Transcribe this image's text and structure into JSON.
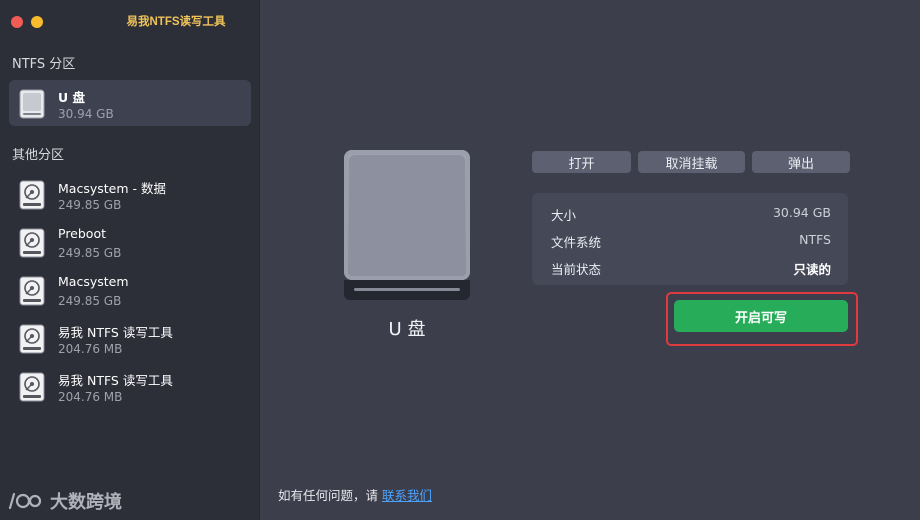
{
  "app": {
    "title": "易我NTFS读写工具"
  },
  "sidebar": {
    "ntfs_label": "NTFS 分区",
    "other_label": "其他分区",
    "ntfs_items": [
      {
        "name": "U 盘",
        "size": "30.94 GB"
      }
    ],
    "other_items": [
      {
        "name": "Macsystem - 数据",
        "size": "249.85 GB"
      },
      {
        "name": "Preboot",
        "size": "249.85 GB"
      },
      {
        "name": "Macsystem",
        "size": "249.85 GB"
      },
      {
        "name": "易我 NTFS 读写工具",
        "size": "204.76 MB"
      },
      {
        "name": "易我 NTFS 读写工具",
        "size": "204.76 MB"
      }
    ]
  },
  "main": {
    "drive_label": "U 盘",
    "actions": {
      "open": "打开",
      "unmount": "取消挂载",
      "eject": "弹出"
    },
    "info": [
      {
        "key": "大小",
        "value": "30.94 GB"
      },
      {
        "key": "文件系统",
        "value": "NTFS"
      },
      {
        "key": "当前状态",
        "value": "只读的"
      }
    ],
    "enable_write": "开启可写",
    "footer_text": "如有任何问题，请 ",
    "footer_link": "联系我们"
  },
  "watermark": {
    "text": "大数跨境"
  },
  "colors": {
    "accent_green": "#27ad5a",
    "highlight_red": "#e03a3f",
    "link_blue": "#4aa3ff",
    "title_gold": "#f0c35a"
  }
}
